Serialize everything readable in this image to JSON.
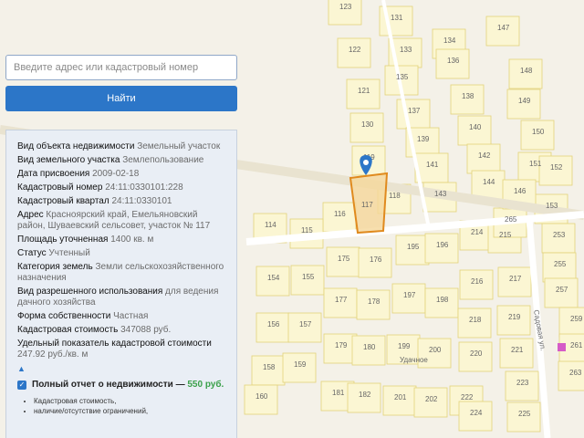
{
  "search": {
    "placeholder": "Введите адрес или кадастровый номер"
  },
  "find_button": {
    "label": "Найти"
  },
  "info": {
    "object_type": {
      "key": "Вид объекта недвижимости",
      "value": "Земельный участок"
    },
    "land_type": {
      "key": "Вид земельного участка",
      "value": "Землепользование"
    },
    "assign_date": {
      "key": "Дата присвоения",
      "value": "2009-02-18"
    },
    "cad_number": {
      "key": "Кадастровый номер",
      "value": "24:11:0330101:228"
    },
    "cad_block": {
      "key": "Кадастровый квартал",
      "value": "24:11:0330101"
    },
    "address": {
      "key": "Адрес",
      "value": "Красноярский край, Емельяновский район, Шуваевский сельсовет, участок № 117"
    },
    "area": {
      "key": "Площадь уточненная",
      "value": "1400 кв. м"
    },
    "status": {
      "key": "Статус",
      "value": "Учтенный"
    },
    "category": {
      "key": "Категория земель",
      "value": "Земли сельскохозяйственного назначения"
    },
    "permitted_use": {
      "key": "Вид разрешенного использования",
      "value": "для ведения дачного хозяйства"
    },
    "ownership": {
      "key": "Форма собственности",
      "value": "Частная"
    },
    "cad_value": {
      "key": "Кадастровая стоимость",
      "value": "347088 руб."
    },
    "unit_value": {
      "key": "Удельный показатель кадастровой стоимости",
      "value": "247.92 руб./кв. м"
    }
  },
  "report": {
    "label": "Полный отчет о недвижимости —",
    "price": "550 руб.",
    "features": [
      "Кадастровая стоимость,",
      "наличие/отсутствие ограничений,"
    ]
  },
  "map": {
    "street_label": "Удачное",
    "road_label": "Садовая ул.",
    "selected_plot": "117",
    "plot_numbers": [
      "123",
      "131",
      "133",
      "134",
      "136",
      "135",
      "122",
      "121",
      "138",
      "137",
      "130",
      "139",
      "140",
      "119",
      "141",
      "142",
      "143",
      "144",
      "118",
      "117",
      "116",
      "114",
      "115",
      "175",
      "176",
      "195",
      "196",
      "214",
      "215",
      "154",
      "155",
      "177",
      "178",
      "197",
      "198",
      "216",
      "217",
      "156",
      "157",
      "179",
      "180",
      "199",
      "200",
      "218",
      "219",
      "158",
      "159",
      "181",
      "182",
      "201",
      "202",
      "220",
      "221",
      "160",
      "222",
      "223",
      "224",
      "225",
      "147",
      "148",
      "149",
      "150",
      "151",
      "152",
      "153",
      "253",
      "255",
      "257",
      "259",
      "261",
      "263",
      "265",
      "146",
      "145"
    ]
  }
}
